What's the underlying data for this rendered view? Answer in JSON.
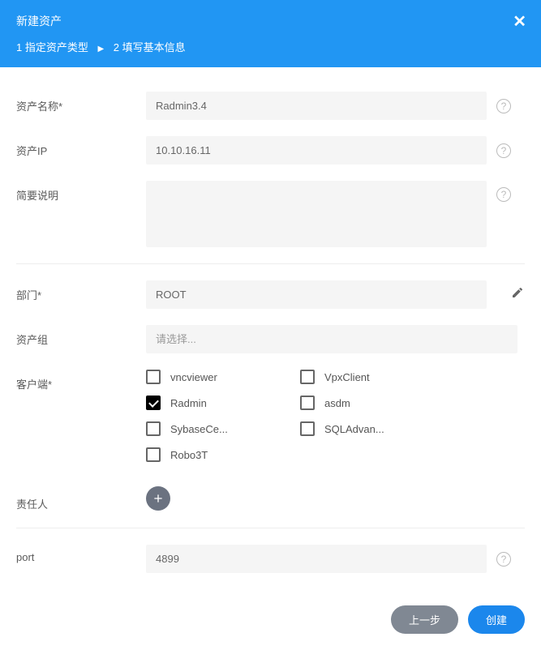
{
  "header": {
    "title": "新建资产",
    "close": "✕",
    "step1": "1 指定资产类型",
    "step_arrow": "▶",
    "step2": "2 填写基本信息"
  },
  "labels": {
    "asset_name": "资产名称*",
    "asset_ip": "资产IP",
    "description": "简要说明",
    "department": "部门*",
    "asset_group": "资产组",
    "client": "客户端*",
    "owner": "责任人",
    "port": "port"
  },
  "values": {
    "asset_name": "Radmin3.4",
    "asset_ip": "10.10.16.11",
    "description": "",
    "department": "ROOT",
    "asset_group_placeholder": "请选择...",
    "port": "4899"
  },
  "clients": [
    {
      "label": "vncviewer",
      "checked": false
    },
    {
      "label": "VpxClient",
      "checked": false
    },
    {
      "label": "Radmin",
      "checked": true
    },
    {
      "label": "asdm",
      "checked": false
    },
    {
      "label": "SybaseCe...",
      "checked": false
    },
    {
      "label": "SQLAdvan...",
      "checked": false
    },
    {
      "label": "Robo3T",
      "checked": false
    }
  ],
  "buttons": {
    "prev": "上一步",
    "create": "创建"
  }
}
